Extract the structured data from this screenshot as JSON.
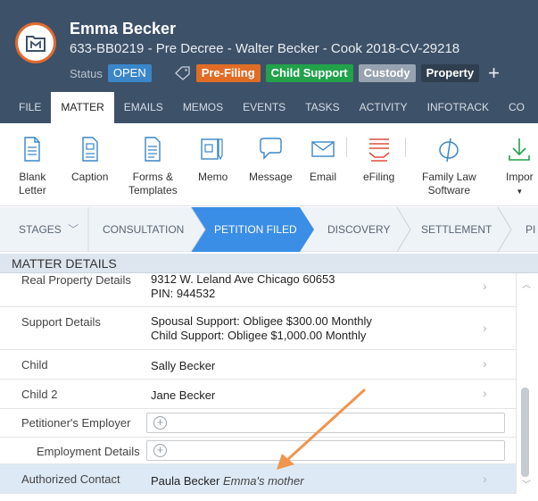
{
  "header": {
    "client_name": "Emma Becker",
    "matter_line": "633-BB0219 - Pre Decree - Walter Becker - Cook 2018-CV-29218",
    "status_label": "Status",
    "status_value": "OPEN",
    "tags": [
      "Pre-Filing",
      "Child Support",
      "Custody",
      "Property"
    ],
    "add_tag": "+"
  },
  "tabs": [
    "FILE",
    "MATTER",
    "EMAILS",
    "MEMOS",
    "EVENTS",
    "TASKS",
    "ACTIVITY",
    "INFOTRACK",
    "CO"
  ],
  "active_tab": "MATTER",
  "ribbon": {
    "blank_letter": [
      "Blank",
      "Letter"
    ],
    "caption": "Caption",
    "forms_templates": [
      "Forms &",
      "Templates"
    ],
    "memo": "Memo",
    "message": "Message",
    "email": "Email",
    "efiling": "eFiling",
    "family_law": [
      "Family Law",
      "Software"
    ],
    "import": "Impor"
  },
  "stages": {
    "label": "STAGES",
    "items": [
      "CONSULTATION",
      "PETITION FILED",
      "DISCOVERY",
      "SETTLEMENT",
      "PI"
    ],
    "active": "PETITION FILED"
  },
  "matter_details": {
    "title": "MATTER DETAILS",
    "rows": [
      {
        "label": "Real Property Details",
        "value_lines": [
          "9312 W. Leland Ave Chicago 60653",
          "PIN: 944532"
        ]
      },
      {
        "label": "Support Details",
        "value_lines": [
          "Spousal Support: Obligee $300.00 Monthly",
          "Child Support: Obligee $1,000.00 Monthly"
        ]
      },
      {
        "label": "Child",
        "value_lines": [
          "Sally Becker"
        ]
      },
      {
        "label": "Child 2",
        "value_lines": [
          "Jane Becker"
        ]
      },
      {
        "label": "Petitioner's Employer",
        "value_lines": []
      },
      {
        "label": "Employment Details",
        "value_lines": []
      },
      {
        "label": "Authorized Contact",
        "value": "Paula Becker",
        "value_note": "Emma's mother"
      }
    ]
  },
  "colors": {
    "header_bg": "#3d5169",
    "accent_orange": "#e06d25",
    "active_stage": "#3a8ee6",
    "highlight_row": "#dde9f5"
  }
}
